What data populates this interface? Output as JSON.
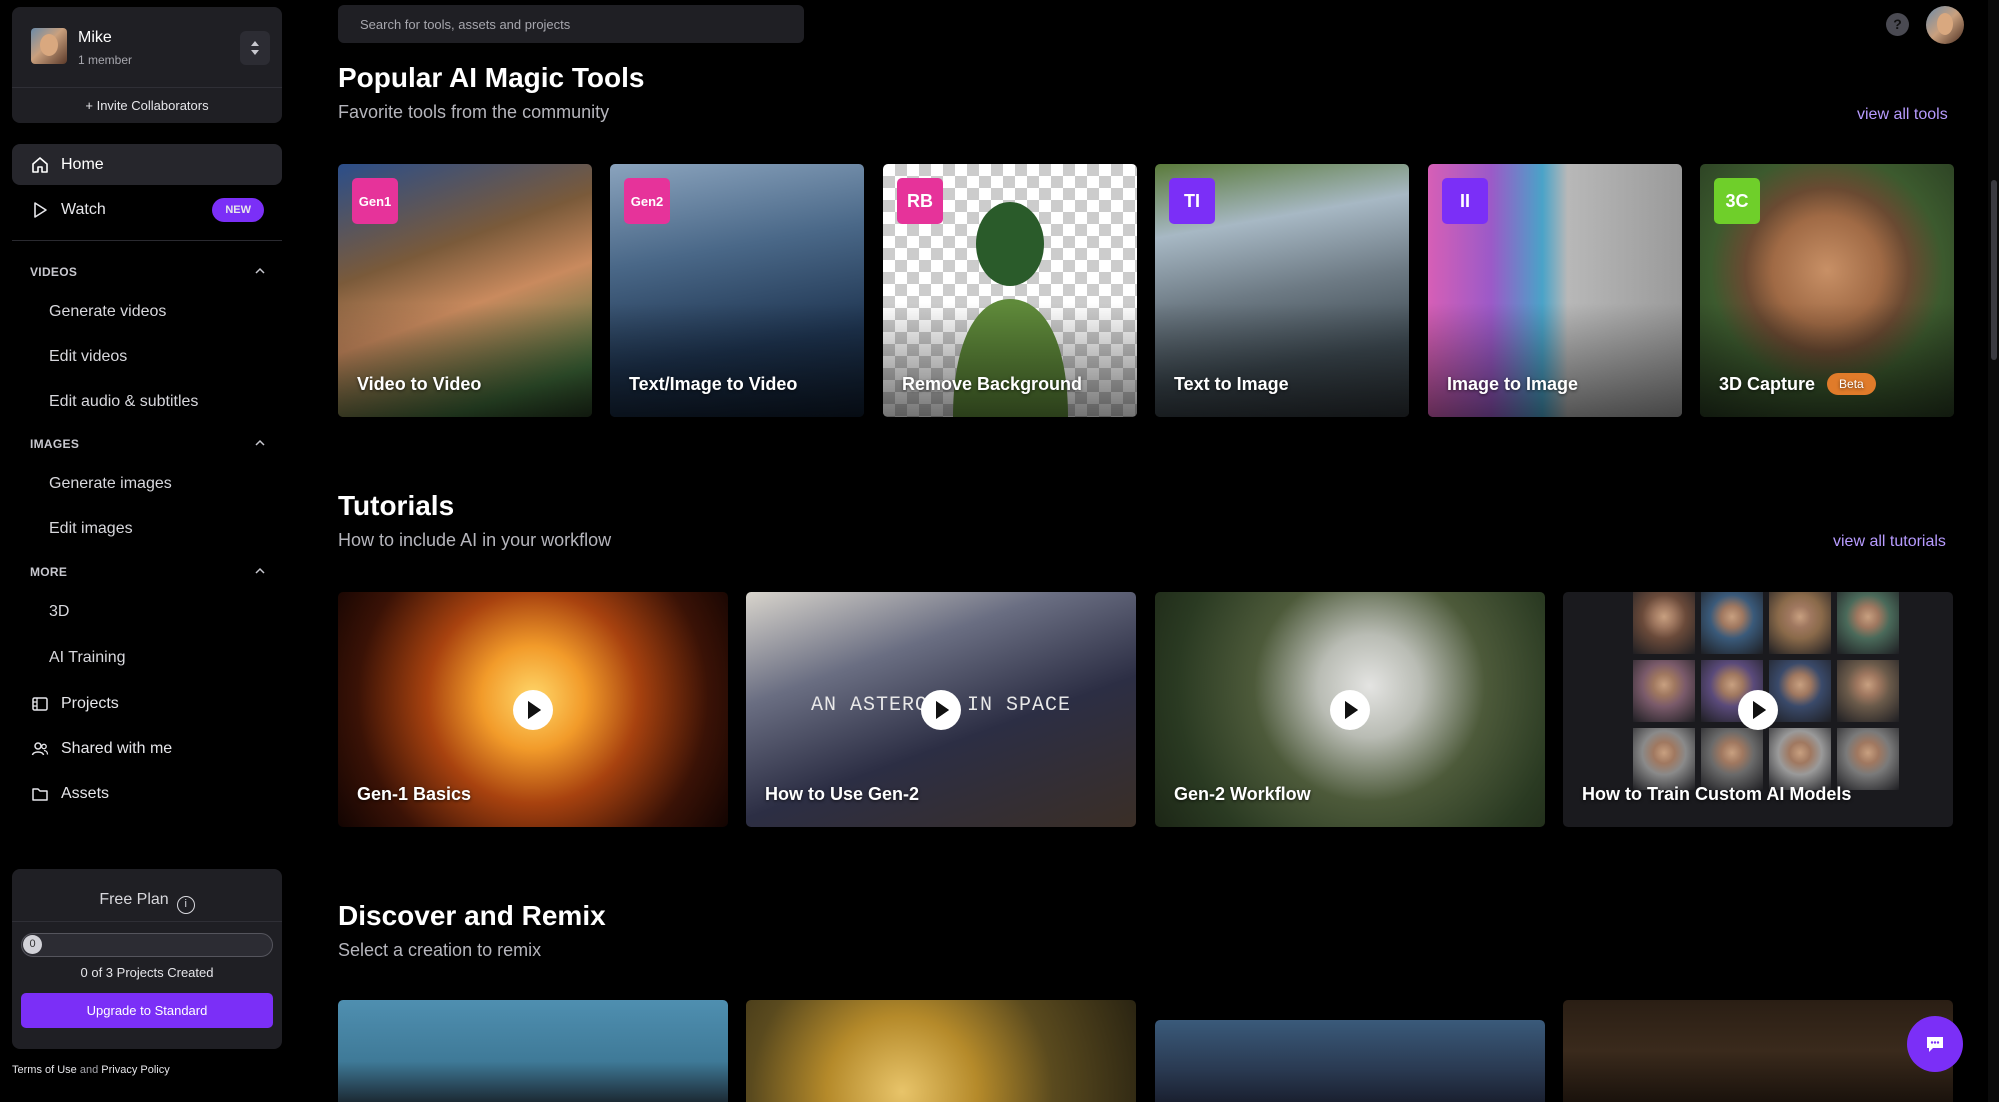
{
  "team": {
    "name": "Mike",
    "members": "1 member",
    "invite_label": "+ Invite Collaborators"
  },
  "nav": {
    "home": "Home",
    "watch": "Watch",
    "watch_badge": "NEW",
    "projects": "Projects",
    "shared": "Shared with me",
    "assets": "Assets"
  },
  "sections": {
    "videos": {
      "label": "VIDEOS",
      "items": [
        "Generate videos",
        "Edit videos",
        "Edit audio & subtitles"
      ]
    },
    "images": {
      "label": "IMAGES",
      "items": [
        "Generate images",
        "Edit images"
      ]
    },
    "more": {
      "label": "MORE",
      "items": [
        "3D",
        "AI Training"
      ]
    }
  },
  "plan": {
    "title": "Free Plan",
    "info_glyph": "i",
    "progress_value": "0",
    "progress_fraction": 0,
    "count_text": "0 of 3 Projects Created",
    "upgrade_label": "Upgrade to Standard"
  },
  "legal": {
    "terms": "Terms of Use",
    "and": "and",
    "privacy": "Privacy Policy"
  },
  "search": {
    "placeholder": "Search for tools, assets and projects"
  },
  "help": {
    "glyph": "?"
  },
  "tools_section": {
    "title": "Popular AI Magic Tools",
    "subtitle": "Favorite tools from the community",
    "view_all": "view all tools",
    "tools": [
      {
        "badge": "Gen1",
        "label": "Video to Video",
        "badge_color": "#e6339a"
      },
      {
        "badge": "Gen2",
        "label": "Text/Image to Video",
        "badge_color": "#e6339a"
      },
      {
        "badge": "RB",
        "label": "Remove Background",
        "badge_color": "#e6339a"
      },
      {
        "badge": "TI",
        "label": "Text to Image",
        "badge_color": "#7b2ff7"
      },
      {
        "badge": "II",
        "label": "Image to Image",
        "badge_color": "#7b2ff7"
      },
      {
        "badge": "3C",
        "label": "3D Capture",
        "badge_color": "#6fcf2a",
        "tag": "Beta"
      }
    ]
  },
  "tutorials_section": {
    "title": "Tutorials",
    "subtitle": "How to include AI in your workflow",
    "view_all": "view all tutorials",
    "tutorials": [
      {
        "label": "Gen-1 Basics"
      },
      {
        "label": "How to Use Gen-2",
        "overlay_text": "AN ASTEROID IN SPACE"
      },
      {
        "label": "Gen-2 Workflow"
      },
      {
        "label": "How to Train Custom AI Models"
      }
    ]
  },
  "remix_section": {
    "title": "Discover and Remix",
    "subtitle": "Select a creation to remix"
  },
  "colors": {
    "accent": "#7b2ff7",
    "link": "#b79bff",
    "panel": "#1f1f24",
    "beta": "#e07b2a"
  }
}
